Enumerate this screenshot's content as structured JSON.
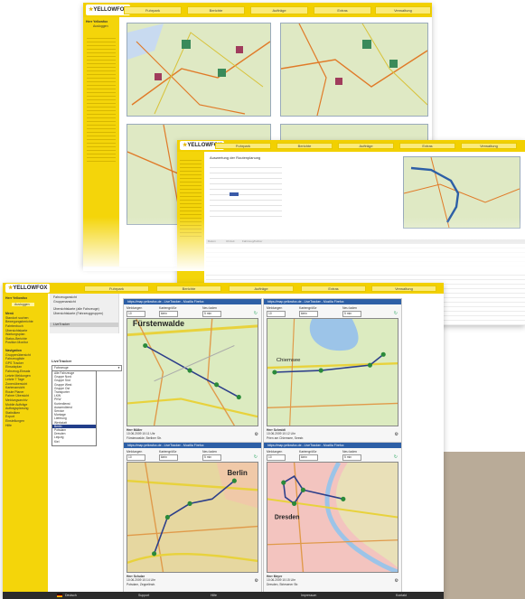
{
  "brand": {
    "logo_text": "YELLOWFOX",
    "accent": "#f2d000",
    "map_green": "#dfe9c4",
    "title_blue": "#2d5fa6"
  },
  "back_window": {
    "tabs": [
      "Fuhrpark",
      "Berichte",
      "Aufträge",
      "Extras",
      "Verwaltung"
    ],
    "sidebar_user": "Herr Yellowfox",
    "sidebar_button": "Ausloggen"
  },
  "mid_window": {
    "tabs": [
      "Fuhrpark",
      "Berichte",
      "Aufträge",
      "Extras",
      "Verwaltung"
    ],
    "heading": "Auswertung der Routenplanung",
    "table_headers": [
      "Datum",
      "Uhrzeit",
      "Fahrzeug/Fahrer"
    ]
  },
  "front_window": {
    "tabs": [
      "Fuhrpark",
      "Berichte",
      "Aufträge",
      "Extras",
      "Verwaltung"
    ],
    "nav_links": [
      "Fahrzeugansicht",
      "Gruppenansicht",
      "Übersichtskarte (alle Fahrzeuge)",
      "Übersichtskarte (Fahrzeuggruppen)",
      "LiveTracker"
    ],
    "sidebar": {
      "user": "Herr Yellowfox",
      "button": "Ausloggen",
      "menu_title": "Menü",
      "menu_items": [
        "Standort suchen",
        "Bewegungsberichte",
        "Fahrtenbuch",
        "Übersichtskarte",
        "Wartungsplan",
        "Status-Berichte",
        "Position Monitor"
      ],
      "section_title": "Navigation",
      "section_items": [
        "Gruppenübersicht",
        "Fahrzeugliste",
        "GPS Tracker",
        "Einsatzplan",
        "Fahrzeug-Einsatz",
        "Letzte Meldungen",
        "Letzte 7 Tage",
        "Zonenübersicht",
        "Kartenansicht",
        "Route Planer",
        "Fahrer Übersicht",
        "Meldungsarchiv",
        "Mobile Aufträge",
        "Auftragsplanung",
        "Statistiken",
        "Export",
        "Einstellungen",
        "Hilfe"
      ]
    },
    "livetracker_label": "LiveTracker",
    "dropdown": {
      "value": "Fahrzeuge",
      "options": [
        "Alle Fahrzeuge",
        "Gruppe Nord",
        "Gruppe Süd",
        "Gruppe West",
        "Gruppe Ost",
        "Transporter",
        "LKW",
        "PKW",
        "Kurierdienst",
        "Aussendienst",
        "Service",
        "Montage",
        "Lieferung",
        "Werkstatt",
        "Berlin",
        "Potsdam",
        "Dresden",
        "Leipzig",
        "Kiel"
      ]
    },
    "panels": [
      {
        "title": "https://map.yellowfox.de - LiveTracker - Mozilla Firefox",
        "labels": [
          "Meldungen",
          "Kartengröße",
          "Neu laden"
        ],
        "selects": [
          "10",
          "klein",
          "5 min"
        ],
        "place": "Fürstenwalde",
        "info": [
          "Herr Müller",
          "10.06.2009 10:11 Uhr",
          "Fürstenwalde, Berliner Str."
        ]
      },
      {
        "title": "https://map.yellowfox.de - LiveTracker - Mozilla Firefox",
        "labels": [
          "Meldungen",
          "Kartengröße",
          "Neu laden"
        ],
        "selects": [
          "10",
          "klein",
          "5 min"
        ],
        "place": "Chiemsee",
        "info": [
          "Herr Schmidt",
          "10.06.2009 10:12 Uhr",
          "Prien am Chiemsee, Seestr."
        ]
      },
      {
        "title": "https://map.yellowfox.de - LiveTracker - Mozilla Firefox",
        "labels": [
          "Meldungen",
          "Kartengröße",
          "Neu laden"
        ],
        "selects": [
          "10",
          "klein",
          "5 min"
        ],
        "place": "Berlin",
        "info": [
          "Herr Schulze",
          "10.06.2009 10:14 Uhr",
          "Potsdam, Zeppelinstr."
        ]
      },
      {
        "title": "https://map.yellowfox.de - LiveTracker - Mozilla Firefox",
        "labels": [
          "Meldungen",
          "Kartengröße",
          "Neu laden"
        ],
        "selects": [
          "10",
          "klein",
          "5 min"
        ],
        "place": "Dresden",
        "info": [
          "Herr Meyer",
          "10.06.2009 10:15 Uhr",
          "Dresden, Striesener Str."
        ]
      }
    ],
    "footer": [
      "Deutsch",
      "Support",
      "Hilfe",
      "Impressum",
      "Kontakt"
    ]
  }
}
